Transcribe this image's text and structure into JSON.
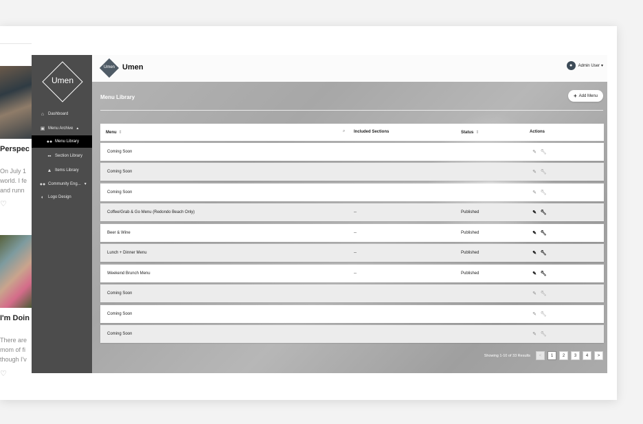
{
  "blog": {
    "post1_title": "Perspec",
    "post1_excerpt": "On July 1\nworld. I fe\nand runn",
    "post2_title": "I'm Doin",
    "post2_excerpt": "There are\nmom of fi\nthough I'v"
  },
  "sidebar": {
    "logo_text": "Umen",
    "items": [
      {
        "label": "Dashboard",
        "icon": "home-icon"
      },
      {
        "label": "Menu Archive",
        "icon": "calendar-icon"
      },
      {
        "label": "Menu Library",
        "icon": "users-icon"
      },
      {
        "label": "Section Library",
        "icon": "boxes-icon"
      },
      {
        "label": "Items Library",
        "icon": "shapes-icon"
      },
      {
        "label": "Community Eng...",
        "icon": "group-icon"
      },
      {
        "label": "Logo Design",
        "icon": "palette-icon"
      }
    ]
  },
  "topbar": {
    "brand_mini": "Umen",
    "brand_name": "Umen",
    "user_name": "Admin User"
  },
  "page": {
    "title": "Menu Library",
    "add_button": "Add Menu"
  },
  "table": {
    "headers": {
      "menu": "Menu",
      "included_sections": "Included Sections",
      "status": "Status",
      "actions": "Actions"
    },
    "rows": [
      {
        "menu": "Coming Soon",
        "sections": "",
        "status": ""
      },
      {
        "menu": "Coming Soon",
        "sections": "",
        "status": ""
      },
      {
        "menu": "Coming Soon",
        "sections": "",
        "status": ""
      },
      {
        "menu": "Coffee/Grab & Go Menu (Redondo Beach Only)",
        "sections": "--",
        "status": "Published"
      },
      {
        "menu": "Beer & Wine",
        "sections": "--",
        "status": "Published"
      },
      {
        "menu": "Lunch + Dinner Menu",
        "sections": "--",
        "status": "Published"
      },
      {
        "menu": "Weekend Brunch Menu",
        "sections": "--",
        "status": "Published"
      },
      {
        "menu": "Coming Soon",
        "sections": "",
        "status": ""
      },
      {
        "menu": "Coming Soon",
        "sections": "",
        "status": ""
      },
      {
        "menu": "Coming Soon",
        "sections": "",
        "status": ""
      }
    ]
  },
  "pagination": {
    "info": "Showing 1-10 of 33 Results",
    "prev": "<",
    "pages": [
      "1",
      "2",
      "3",
      "4"
    ],
    "next": ">",
    "current": "1"
  }
}
